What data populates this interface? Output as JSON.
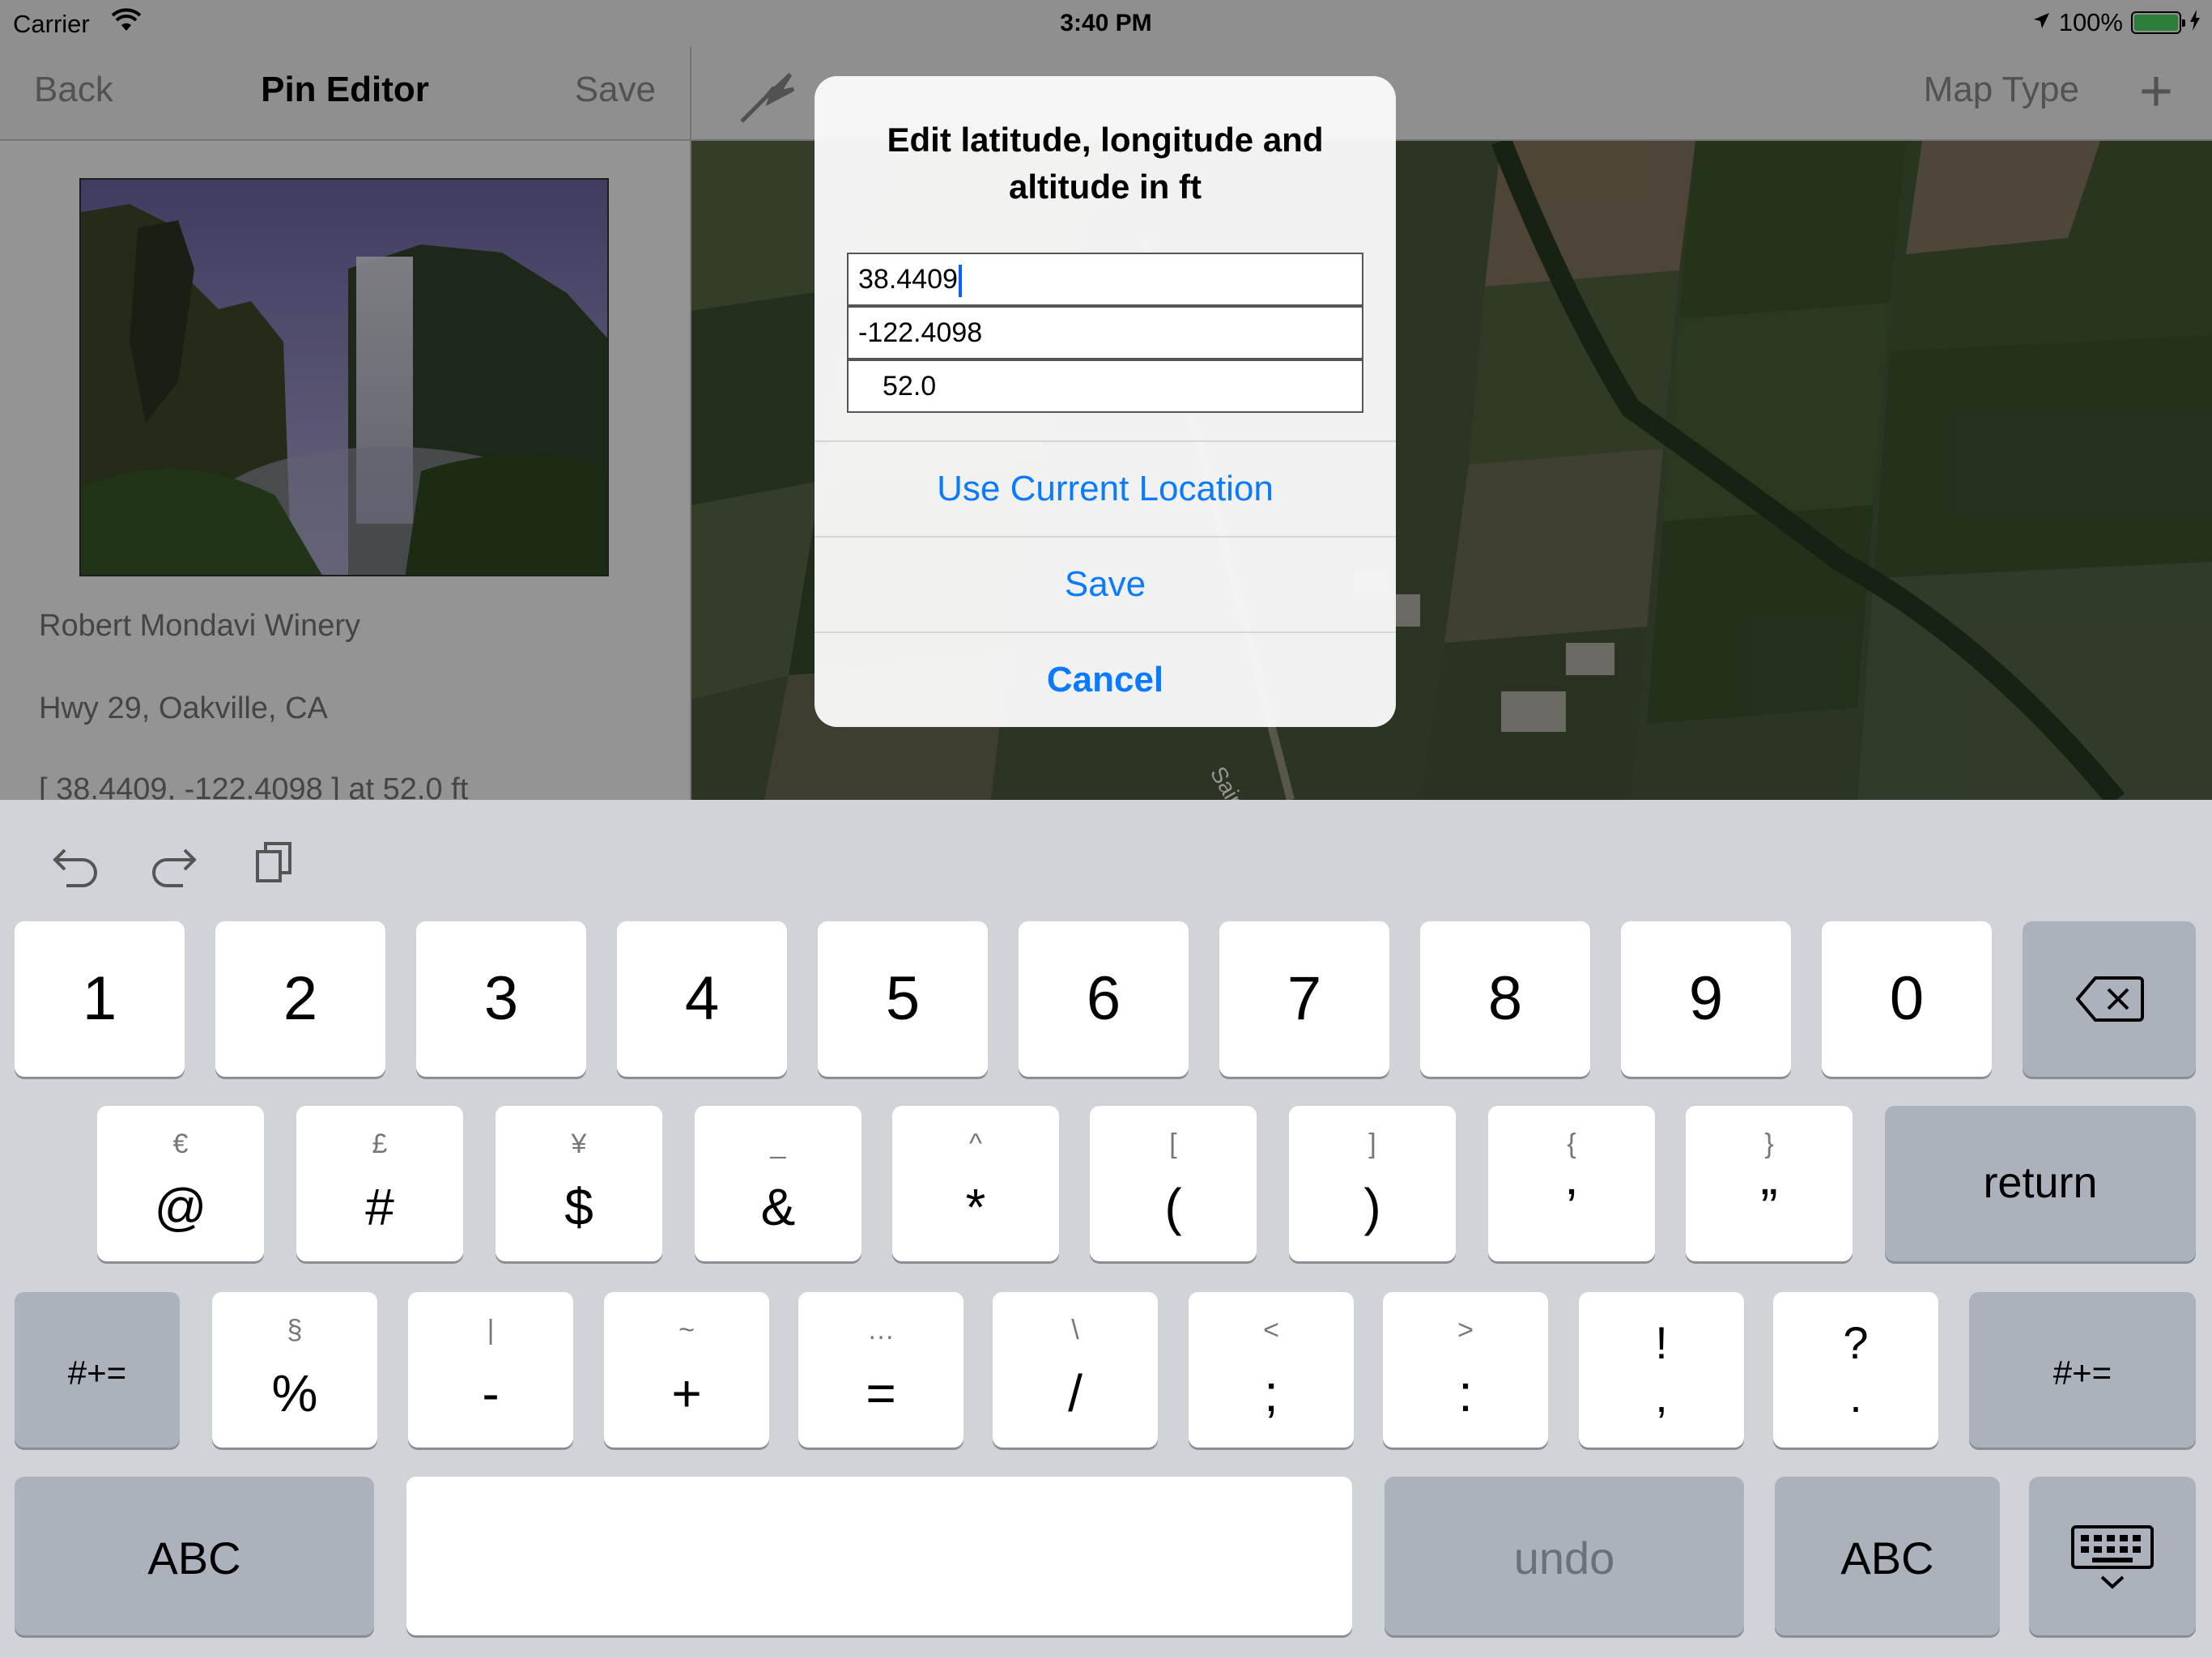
{
  "status_bar": {
    "carrier": "Carrier",
    "time": "3:40 PM",
    "battery": "100%"
  },
  "master": {
    "back_label": "Back",
    "title": "Pin Editor",
    "save_label": "Save",
    "place_name": "Robert Mondavi Winery",
    "address": "Hwy 29, Oakville, CA",
    "coords_text": "[ 38.4409, -122.4098 ] at    52.0          ft"
  },
  "detail": {
    "map_type_label": "Map Type",
    "add_label": "+",
    "map_label": "Saint"
  },
  "alert": {
    "title": "Edit latitude, longitude and altitude in ft",
    "latitude": "38.4409",
    "longitude": "-122.4098",
    "altitude": "52.0",
    "use_current_location": "Use Current Location",
    "save": "Save",
    "cancel": "Cancel"
  },
  "keyboard": {
    "row1": [
      "1",
      "2",
      "3",
      "4",
      "5",
      "6",
      "7",
      "8",
      "9",
      "0"
    ],
    "row2": [
      {
        "main": "@",
        "alt": "€"
      },
      {
        "main": "#",
        "alt": "£"
      },
      {
        "main": "$",
        "alt": "¥"
      },
      {
        "main": "&",
        "alt": "_"
      },
      {
        "main": "*",
        "alt": "^"
      },
      {
        "main": "(",
        "alt": "["
      },
      {
        "main": ")",
        "alt": "]"
      },
      {
        "main": "’",
        "alt": "{"
      },
      {
        "main": "”",
        "alt": "}"
      }
    ],
    "row3": [
      {
        "main": "%",
        "alt": "§"
      },
      {
        "main": "-",
        "alt": "|"
      },
      {
        "main": "+",
        "alt": "~"
      },
      {
        "main": "=",
        "alt": "…"
      },
      {
        "main": "/",
        "alt": "\\"
      },
      {
        "main": ";",
        "alt": "<"
      },
      {
        "main": ":",
        "alt": ">"
      },
      {
        "main": "!",
        "alt": ","
      },
      {
        "main": "?",
        "alt": "."
      }
    ],
    "return_label": "return",
    "shift_label": "#+=",
    "abc_label": "ABC",
    "undo_label": "undo"
  }
}
